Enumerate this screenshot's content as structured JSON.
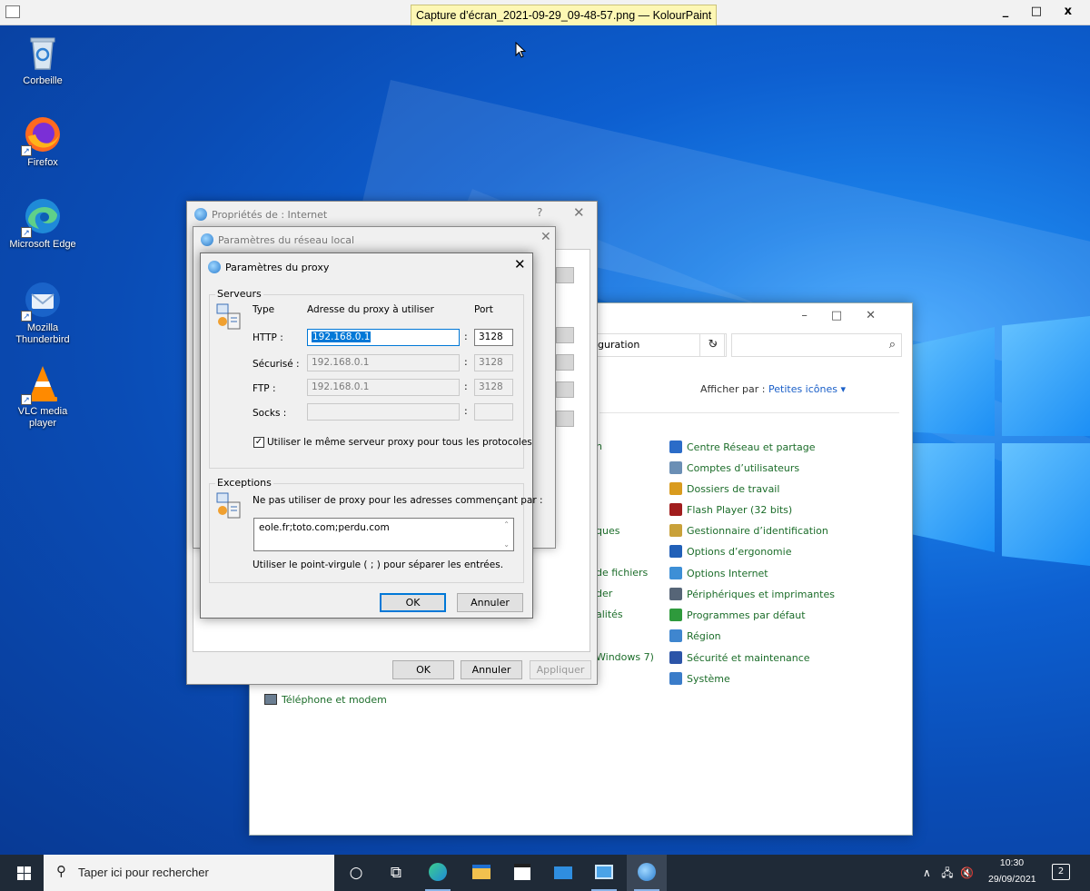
{
  "kolourpaint": {
    "window_title": "Capture d’écran_2021-09-29_09-48-57.png — KolourPaint",
    "controls": "_ □ x"
  },
  "desktop": {
    "icons": [
      {
        "label": "Corbeille",
        "icon": "recycle-bin-icon"
      },
      {
        "label": "Firefox",
        "icon": "firefox-icon"
      },
      {
        "label": "Microsoft Edge",
        "icon": "edge-icon"
      },
      {
        "label": "Mozilla Thunderbird",
        "icon": "thunderbird-icon"
      },
      {
        "label": "VLC media player",
        "icon": "vlc-icon"
      }
    ]
  },
  "control_panel": {
    "address_fragment": "guration",
    "view_label": "Afficher par :",
    "view_value": "Petites icônes ▾",
    "left_fragments": [
      "n",
      "ques",
      "de fichiers",
      "der",
      "alités",
      "Windows 7)"
    ],
    "bottom_item": "Téléphone et modem",
    "items": [
      {
        "label": "Centre Réseau et partage",
        "color": "#2b6cc8"
      },
      {
        "label": "Comptes d’utilisateurs",
        "color": "#6b8fb5"
      },
      {
        "label": "Dossiers de travail",
        "color": "#d99b1e"
      },
      {
        "label": "Flash Player (32 bits)",
        "color": "#a11d1d"
      },
      {
        "label": "Gestionnaire d’identification",
        "color": "#c9a13a"
      },
      {
        "label": "Options d’ergonomie",
        "color": "#2160b8"
      },
      {
        "label": "Options Internet",
        "color": "#3d8fd6"
      },
      {
        "label": "Périphériques et imprimantes",
        "color": "#566577"
      },
      {
        "label": "Programmes par défaut",
        "color": "#2e9a3c"
      },
      {
        "label": "Région",
        "color": "#3f86cf"
      },
      {
        "label": "Sécurité et maintenance",
        "color": "#2c55a8"
      },
      {
        "label": "Système",
        "color": "#3a7cc9"
      }
    ]
  },
  "internet_properties": {
    "title": "Propriétés de : Internet",
    "help": "?",
    "close": "✕",
    "ok": "OK",
    "cancel": "Annuler",
    "apply": "Appliquer"
  },
  "lan_settings": {
    "title": "Paramètres du réseau local",
    "close": "✕"
  },
  "proxy_settings": {
    "title": "Paramètres du proxy",
    "close": "✕",
    "servers_group": "Serveurs",
    "col_type": "Type",
    "col_address": "Adresse du proxy à utiliser",
    "col_port": "Port",
    "rows": [
      {
        "type": "HTTP :",
        "address": "192.168.0.1",
        "port": "3128"
      },
      {
        "type": "Sécurisé :",
        "address": "192.168.0.1",
        "port": "3128"
      },
      {
        "type": "FTP :",
        "address": "192.168.0.1",
        "port": "3128"
      },
      {
        "type": "Socks :",
        "address": "",
        "port": ""
      }
    ],
    "same_proxy_label": "Utiliser le même serveur proxy pour tous les protocoles",
    "same_proxy_checked": true,
    "exceptions_group": "Exceptions",
    "exceptions_desc": "Ne pas utiliser de proxy pour les adresses commençant par :",
    "exceptions_value": "eole.fr;toto.com;perdu.com",
    "exceptions_hint": "Utiliser le point-virgule ( ; ) pour séparer les entrées.",
    "ok": "OK",
    "cancel": "Annuler"
  },
  "taskbar": {
    "search_placeholder": "Taper ici pour rechercher",
    "time": "10:30",
    "date": "29/09/2021",
    "notifications": "2"
  }
}
